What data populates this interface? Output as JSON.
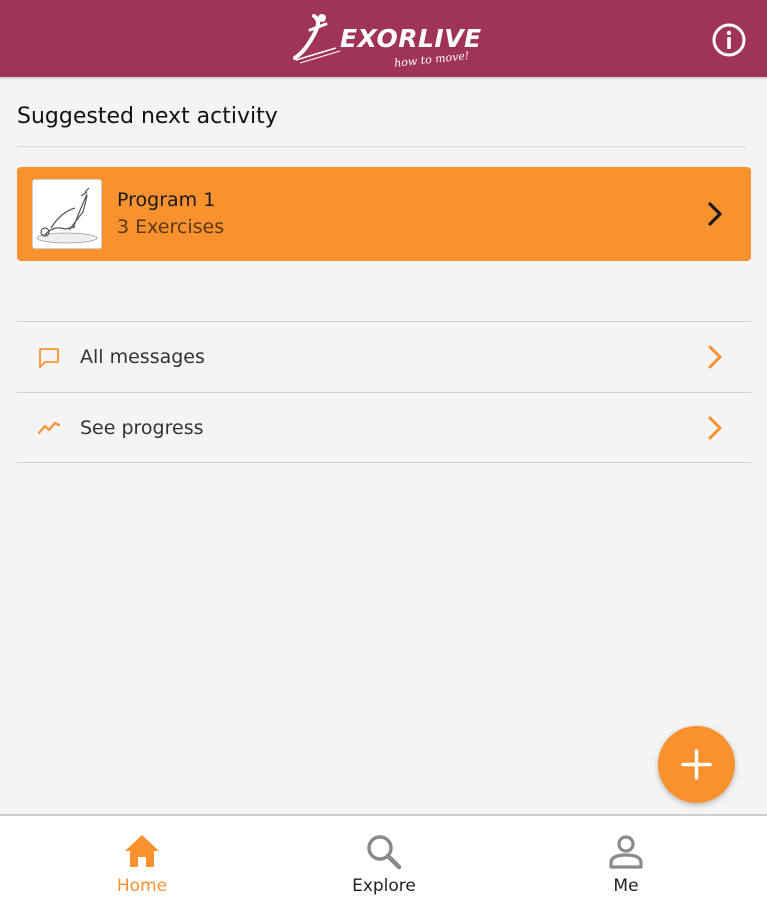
{
  "header": {
    "logo_text": "EXORLIVE",
    "logo_tagline": "how to move!",
    "info_icon": "info-icon",
    "background_color": "#a03359"
  },
  "suggested": {
    "title": "Suggested next activity",
    "program": {
      "name": "Program 1",
      "exercise_count": "3 Exercises",
      "card_color": "#fa912f"
    }
  },
  "list": {
    "items": [
      {
        "label": "All messages",
        "icon": "message-icon"
      },
      {
        "label": "See progress",
        "icon": "progress-chart-icon"
      }
    ]
  },
  "fab": {
    "icon": "plus-icon"
  },
  "bottom_nav": {
    "items": [
      {
        "label": "Home",
        "icon": "home-icon",
        "active": true
      },
      {
        "label": "Explore",
        "icon": "search-icon",
        "active": false
      },
      {
        "label": "Me",
        "icon": "person-icon",
        "active": false
      }
    ]
  },
  "colors": {
    "accent": "#fa912f",
    "brand": "#a03359"
  }
}
